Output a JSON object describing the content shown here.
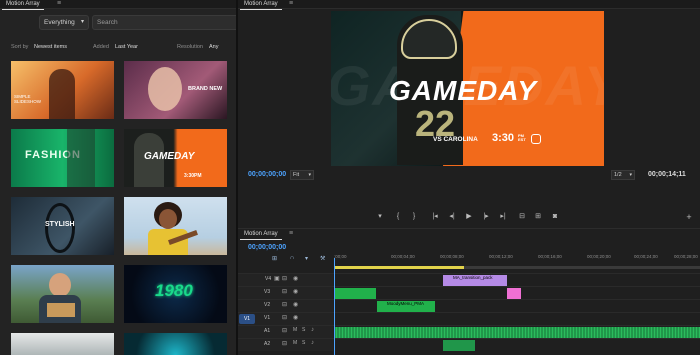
{
  "left_panel": {
    "title": "Motion Array",
    "search": {
      "category": "Everything",
      "placeholder": "Search"
    },
    "filters": {
      "sort_label": "Sort by",
      "sort_value": "Newest items",
      "added_label": "Added",
      "added_value": "Last Year",
      "resolution_label": "Resolution",
      "resolution_value": "Any"
    },
    "thumbnails": [
      {
        "caption": "SIMPLE SLIDESHOW"
      },
      {
        "caption": "BRAND NEW"
      },
      {
        "caption": "FASHION"
      },
      {
        "caption": "GAMEDAY",
        "sub": "3:30PM"
      },
      {
        "caption": "STYLISH"
      },
      {
        "caption": ""
      },
      {
        "caption": ""
      },
      {
        "caption": "1980"
      },
      {
        "caption": ""
      },
      {
        "caption": ""
      }
    ]
  },
  "program_monitor": {
    "title": "Motion Array",
    "preview": {
      "headline": "GAMEDAY",
      "bg_word": "GAMEDAY",
      "matchup": "VS CAROLINA",
      "time": "3:30",
      "time_suffix": "PM EST",
      "jersey": "22"
    },
    "timecode_current": "00;00;00;00",
    "fit_value": "Fit",
    "resolution_value": "1/2",
    "timecode_duration": "00;00;14;11"
  },
  "transport": {
    "buttons": [
      "marker",
      "in-point",
      "out-point",
      "go-to-in",
      "step-back",
      "play",
      "step-forward",
      "go-to-out",
      "insert",
      "overwrite",
      "export-frame",
      "add"
    ]
  },
  "timeline": {
    "title": "Motion Array",
    "timecode": "00;00;00;00",
    "ruler_ticks": [
      ":00;00",
      "00;00;04;00",
      "00;00;08;00",
      "00;00;12;00",
      "00;00;16;00",
      "00;00;20;00",
      "00;00;24;00",
      "00;00;28;00"
    ],
    "tracks": [
      {
        "name": "V4"
      },
      {
        "name": "V3"
      },
      {
        "name": "V2"
      },
      {
        "name": "V1",
        "target": "V1"
      },
      {
        "name": "A1",
        "m": "M",
        "s": "S"
      },
      {
        "name": "A2",
        "m": "M",
        "s": "S"
      }
    ],
    "clips": {
      "v4": "MA_transition_pack",
      "v2": "MoodyMenu_PMA",
      "v3": "fx"
    }
  },
  "colors": {
    "accent": "#4da3ff",
    "clip_green": "#21b14b",
    "clip_purple": "#b58ae6",
    "clip_pink": "#f070d4",
    "orange": "#f26a1b"
  }
}
